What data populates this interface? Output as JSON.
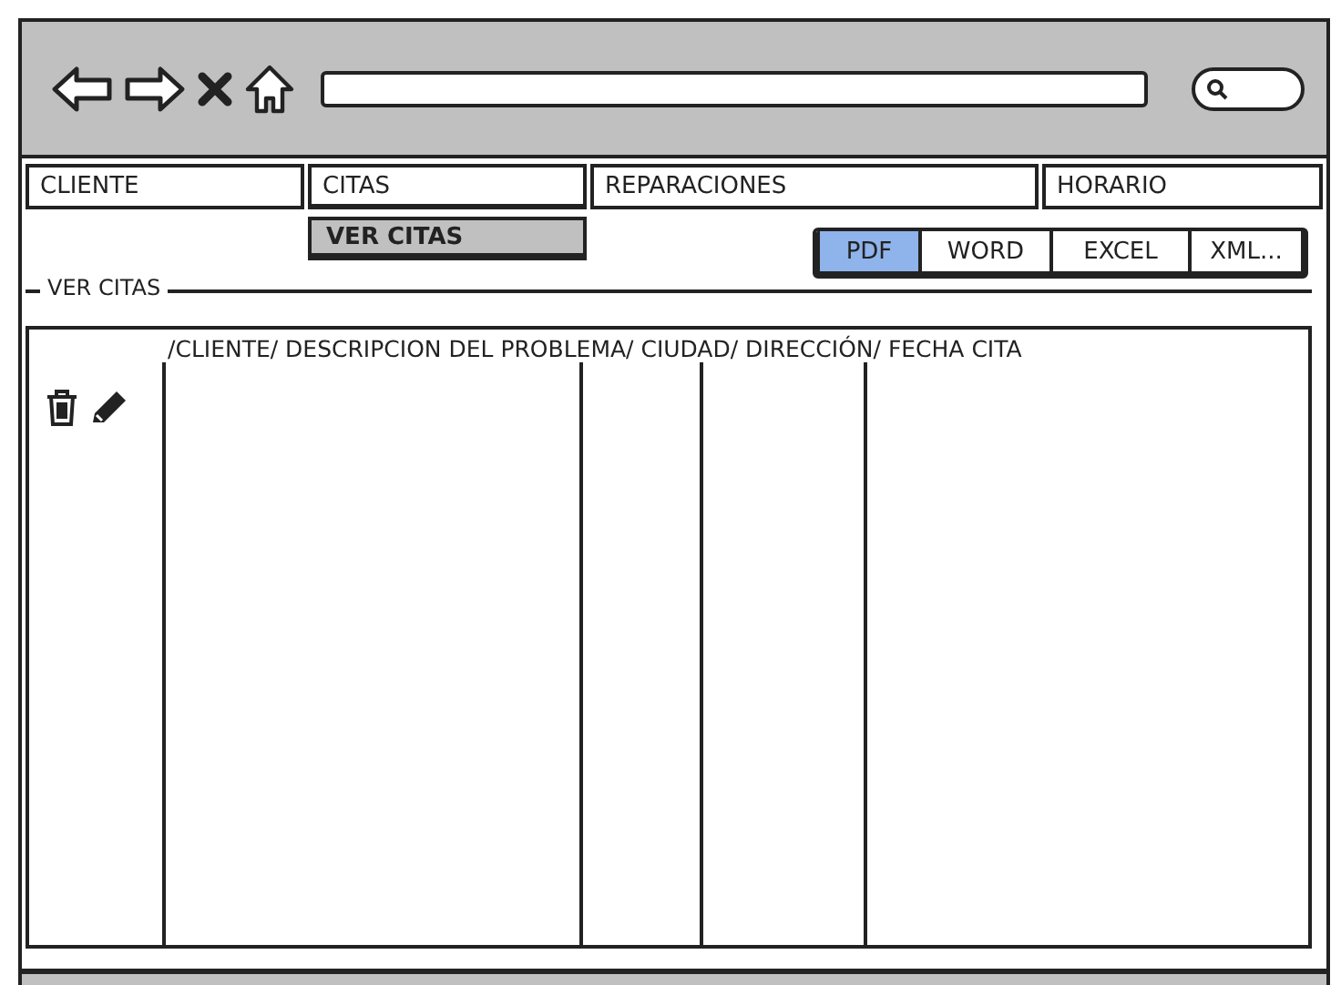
{
  "menu": [
    {
      "label": "CLIENTE",
      "expanded": false
    },
    {
      "label": "CITAS",
      "expanded": true,
      "submenu": [
        "VER CITAS"
      ]
    },
    {
      "label": "REPARACIONES",
      "expanded": false
    },
    {
      "label": "HORARIO",
      "expanded": false
    }
  ],
  "export_buttons": [
    {
      "label": "PDF",
      "selected": true
    },
    {
      "label": "WORD",
      "selected": false
    },
    {
      "label": "EXCEL",
      "selected": false
    },
    {
      "label": "XML...",
      "selected": false
    }
  ],
  "panel": {
    "title": "VER CITAS",
    "header": "/CLIENTE/ DESCRIPCION DEL PROBLEMA/ CIUDAD/ DIRECCIÓN/ FECHA CITA"
  }
}
